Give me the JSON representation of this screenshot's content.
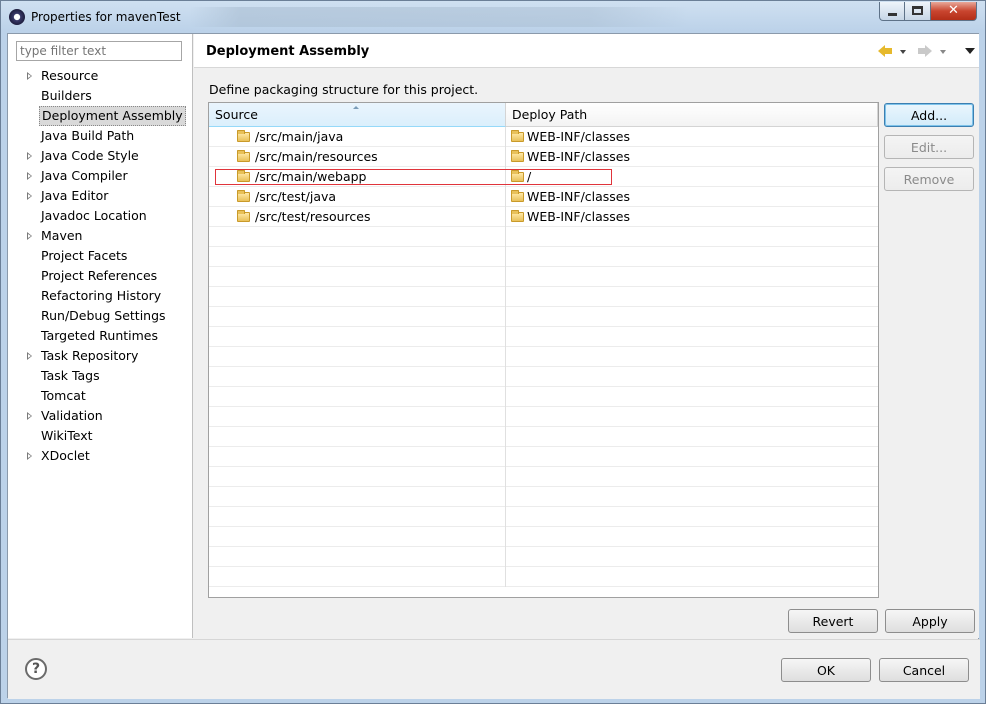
{
  "window": {
    "title": "Properties for mavenTest",
    "close_glyph": "✕"
  },
  "filter": {
    "placeholder": "type filter text"
  },
  "tree": {
    "items": [
      {
        "label": "Resource",
        "expandable": true
      },
      {
        "label": "Builders",
        "expandable": false
      },
      {
        "label": "Deployment Assembly",
        "expandable": false,
        "selected": true
      },
      {
        "label": "Java Build Path",
        "expandable": false
      },
      {
        "label": "Java Code Style",
        "expandable": true
      },
      {
        "label": "Java Compiler",
        "expandable": true
      },
      {
        "label": "Java Editor",
        "expandable": true
      },
      {
        "label": "Javadoc Location",
        "expandable": false
      },
      {
        "label": "Maven",
        "expandable": true
      },
      {
        "label": "Project Facets",
        "expandable": false
      },
      {
        "label": "Project References",
        "expandable": false
      },
      {
        "label": "Refactoring History",
        "expandable": false
      },
      {
        "label": "Run/Debug Settings",
        "expandable": false
      },
      {
        "label": "Targeted Runtimes",
        "expandable": false
      },
      {
        "label": "Task Repository",
        "expandable": true
      },
      {
        "label": "Task Tags",
        "expandable": false
      },
      {
        "label": "Tomcat",
        "expandable": false
      },
      {
        "label": "Validation",
        "expandable": true
      },
      {
        "label": "WikiText",
        "expandable": false
      },
      {
        "label": "XDoclet",
        "expandable": true
      }
    ]
  },
  "page": {
    "title": "Deployment Assembly",
    "description": "Define packaging structure for this project."
  },
  "table": {
    "columns": {
      "source": "Source",
      "deploy": "Deploy Path"
    },
    "rows": [
      {
        "source": "/src/main/java",
        "deploy": "WEB-INF/classes"
      },
      {
        "source": "/src/main/resources",
        "deploy": "WEB-INF/classes"
      },
      {
        "source": "/src/main/webapp",
        "deploy": "/",
        "highlighted": true
      },
      {
        "source": "/src/test/java",
        "deploy": "WEB-INF/classes"
      },
      {
        "source": "/src/test/resources",
        "deploy": "WEB-INF/classes"
      }
    ]
  },
  "buttons": {
    "add": "Add...",
    "edit": "Edit...",
    "remove": "Remove",
    "revert": "Revert",
    "apply": "Apply",
    "ok": "OK",
    "cancel": "Cancel",
    "help": "?"
  },
  "colors": {
    "highlight_border": "#e0343b",
    "selection_bg": "#d9d9d9",
    "folder": "#e8c15a"
  }
}
